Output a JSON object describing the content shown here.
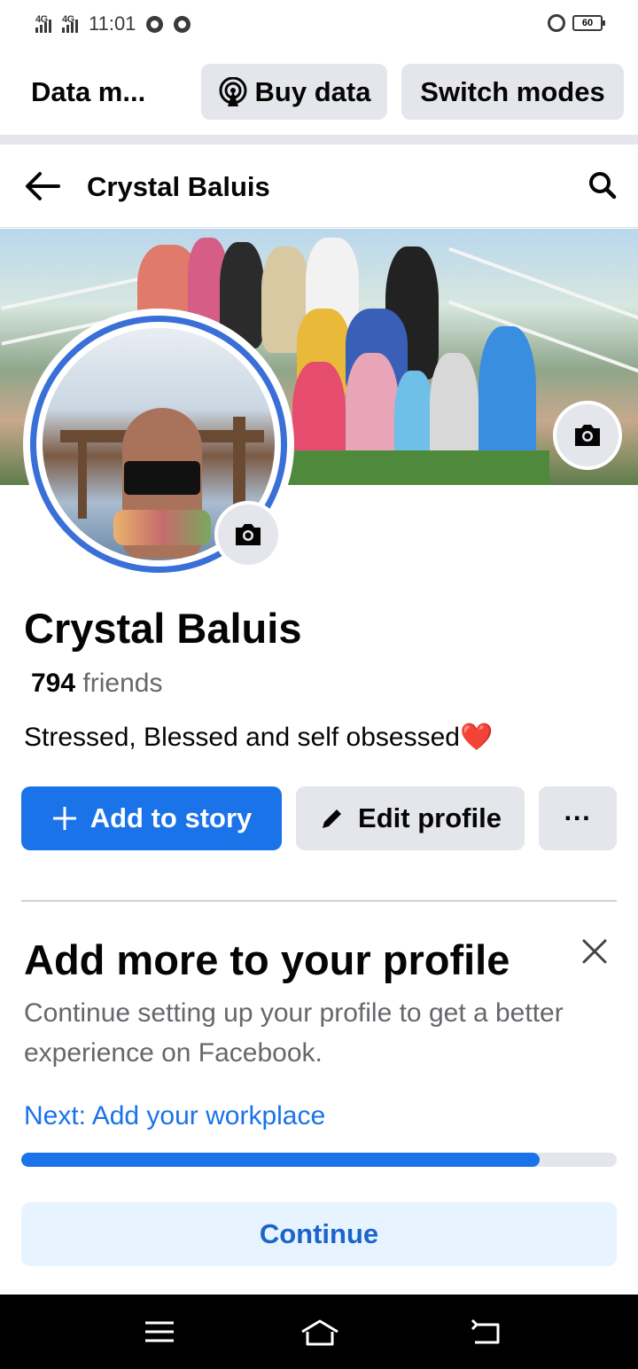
{
  "status_bar": {
    "network1": "4G",
    "network2": "4G",
    "time": "11:01",
    "battery": "60"
  },
  "data_bar": {
    "title": "Data m...",
    "buy_data": "Buy data",
    "switch_modes": "Switch modes"
  },
  "header": {
    "title": "Crystal Baluis"
  },
  "profile": {
    "name": "Crystal Baluis",
    "friends_count": "794",
    "friends_label": " friends",
    "bio": "Stressed, Blessed and self obsessed",
    "bio_emoji": "❤️"
  },
  "actions": {
    "add_story": "Add to story",
    "edit_profile": "Edit profile",
    "more": "···"
  },
  "add_more": {
    "title": "Add more to your profile",
    "description": "Continue setting up your profile to get a better experience on Facebook.",
    "next": "Next: Add your workplace",
    "progress_percent": 87,
    "continue": "Continue"
  },
  "colors": {
    "accent": "#1a73e8",
    "ring": "#3a6fd8",
    "pill_bg": "#e4e6eb",
    "continue_bg": "#e7f3ff"
  }
}
